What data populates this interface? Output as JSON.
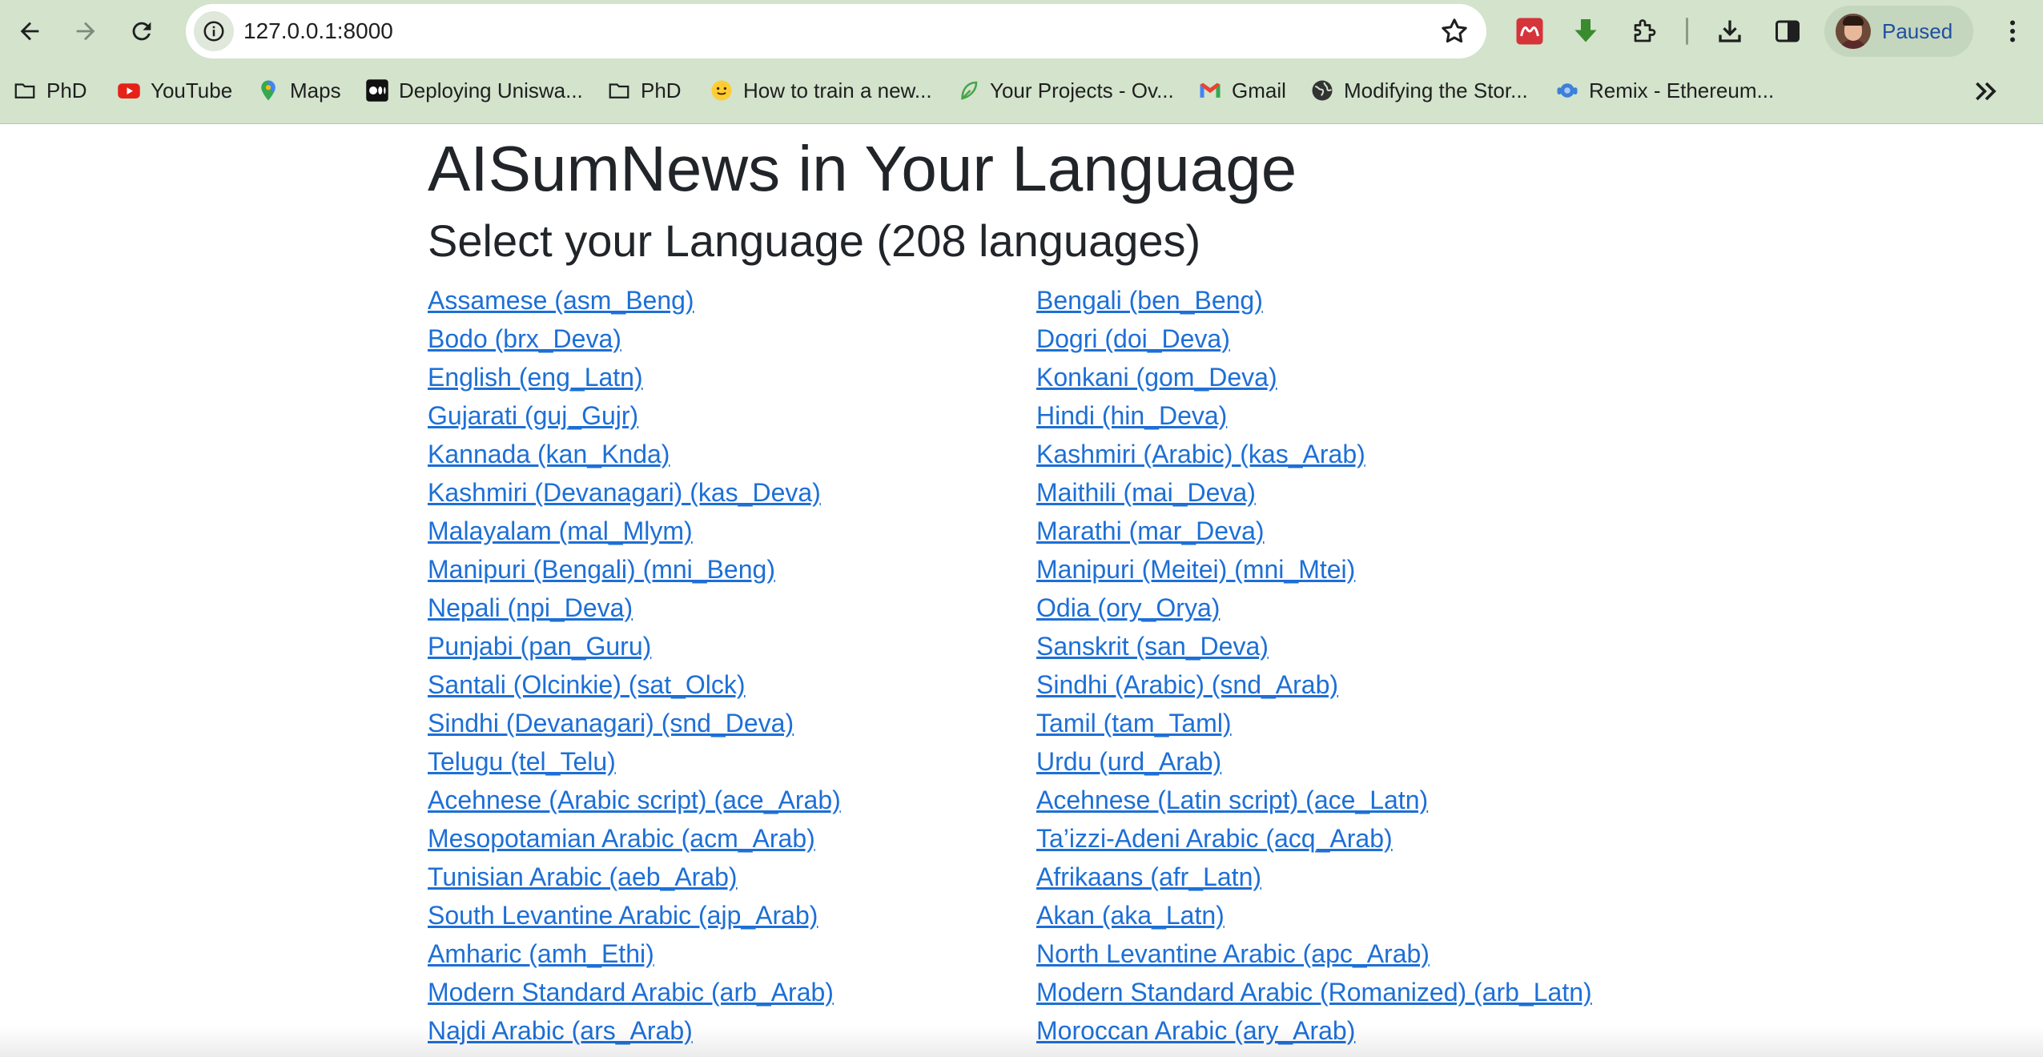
{
  "browser": {
    "url": "127.0.0.1:8000",
    "profile_label": "Paused",
    "bookmarks": [
      {
        "label": "PhD",
        "icon": "folder-icon"
      },
      {
        "label": "YouTube",
        "icon": "youtube-icon"
      },
      {
        "label": "Maps",
        "icon": "maps-pin-icon"
      },
      {
        "label": "Deploying Uniswa...",
        "icon": "medium-icon"
      },
      {
        "label": "PhD",
        "icon": "folder-icon"
      },
      {
        "label": "How to train a new...",
        "icon": "hugging-face-icon"
      },
      {
        "label": "Your Projects - Ov...",
        "icon": "leaf-icon"
      },
      {
        "label": "Gmail",
        "icon": "gmail-icon"
      },
      {
        "label": "Modifying the Stor...",
        "icon": "globe-icon"
      },
      {
        "label": "Remix - Ethereum...",
        "icon": "remix-icon"
      }
    ]
  },
  "page": {
    "title": "AISumNews in Your Language",
    "subtitle": "Select your Language (208 languages)",
    "languages": [
      "Assamese (asm_Beng)",
      "Bengali (ben_Beng)",
      "Bodo (brx_Deva)",
      "Dogri (doi_Deva)",
      "English (eng_Latn)",
      "Konkani (gom_Deva)",
      "Gujarati (guj_Gujr)",
      "Hindi (hin_Deva)",
      "Kannada (kan_Knda)",
      "Kashmiri (Arabic) (kas_Arab)",
      "Kashmiri (Devanagari) (kas_Deva)",
      "Maithili (mai_Deva)",
      "Malayalam (mal_Mlym)",
      "Marathi (mar_Deva)",
      "Manipuri (Bengali) (mni_Beng)",
      "Manipuri (Meitei) (mni_Mtei)",
      "Nepali (npi_Deva)",
      "Odia (ory_Orya)",
      "Punjabi (pan_Guru)",
      "Sanskrit (san_Deva)",
      "Santali (Olcinkie) (sat_Olck)",
      "Sindhi (Arabic) (snd_Arab)",
      "Sindhi (Devanagari) (snd_Deva)",
      "Tamil (tam_Taml)",
      "Telugu (tel_Telu)",
      "Urdu (urd_Arab)",
      "Acehnese (Arabic script) (ace_Arab)",
      "Acehnese (Latin script) (ace_Latn)",
      "Mesopotamian Arabic (acm_Arab)",
      "Ta’izzi-Adeni Arabic (acq_Arab)",
      "Tunisian Arabic (aeb_Arab)",
      "Afrikaans (afr_Latn)",
      "South Levantine Arabic (ajp_Arab)",
      "Akan (aka_Latn)",
      "Amharic (amh_Ethi)",
      "North Levantine Arabic (apc_Arab)",
      "Modern Standard Arabic (arb_Arab)",
      "Modern Standard Arabic (Romanized) (arb_Latn)",
      "Najdi Arabic (ars_Arab)",
      "Moroccan Arabic (ary_Arab)"
    ]
  }
}
